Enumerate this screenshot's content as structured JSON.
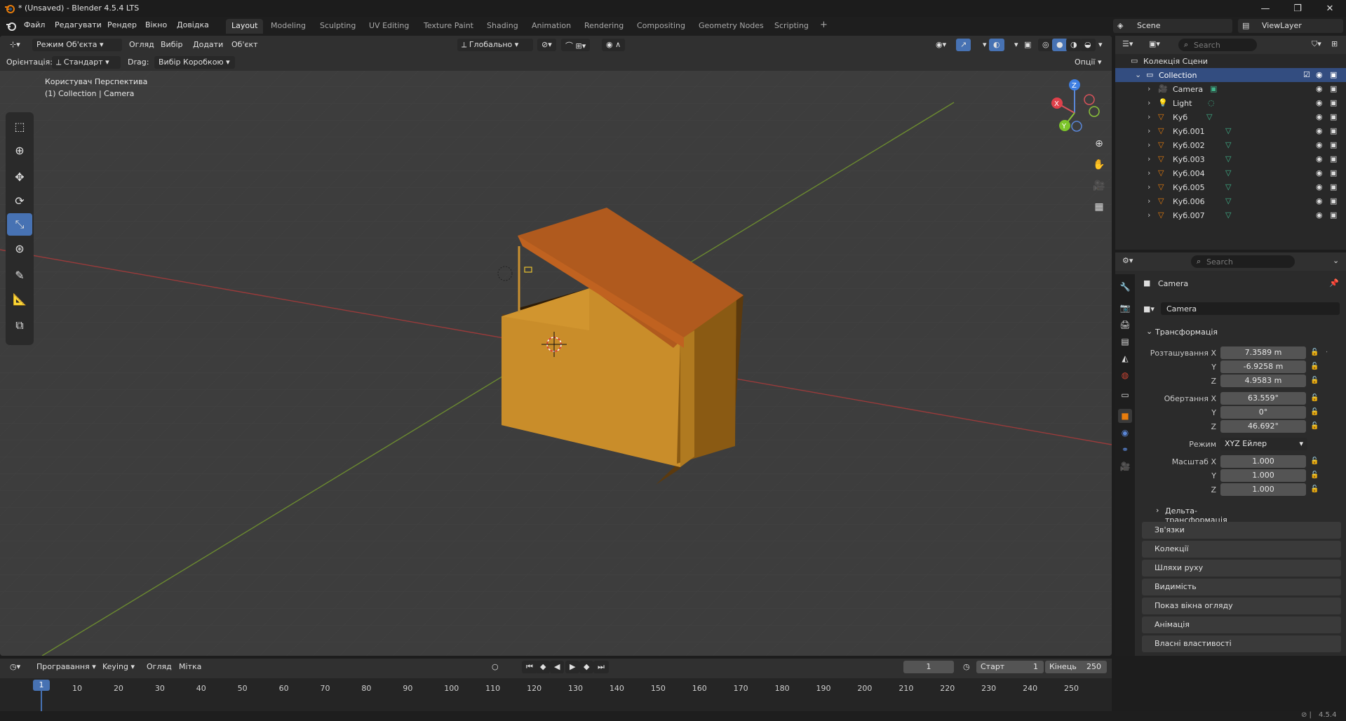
{
  "window": {
    "title": "* (Unsaved) - Blender 4.5.4 LTS"
  },
  "menu": [
    "Файл",
    "Редагувати",
    "Рендер",
    "Вікно",
    "Довідка"
  ],
  "workspaces": [
    "Layout",
    "Modeling",
    "Sculpting",
    "UV Editing",
    "Texture Paint",
    "Shading",
    "Animation",
    "Rendering",
    "Compositing",
    "Geometry Nodes",
    "Scripting"
  ],
  "workspace_add": "+",
  "scene": {
    "name": "Scene",
    "view_layer": "ViewLayer"
  },
  "viewport": {
    "mode": "Режим Об'єкта",
    "header_menus": [
      "Огляд",
      "Вибір",
      "Додати",
      "Об'єкт"
    ],
    "transform_orientation": "Глобально",
    "orientation_label": "Орієнтація:",
    "orientation_value": "Стандарт",
    "drag_label": "Drag:",
    "drag_value": "Вибір Коробкою",
    "options": "Опції",
    "overlay_title": "Користувач Перспектива",
    "overlay_subtitle": "(1) Collection | Camera",
    "gizmo": {
      "x": "X",
      "y": "Y",
      "z": "Z"
    }
  },
  "outliner": {
    "search_placeholder": "Search",
    "root": "Колекція Сцени",
    "collection": "Collection",
    "items": [
      "Camera",
      "Light",
      "Куб",
      "Куб.001",
      "Куб.002",
      "Куб.003",
      "Куб.004",
      "Куб.005",
      "Куб.006",
      "Куб.007"
    ]
  },
  "properties": {
    "search_placeholder": "Search",
    "object_name": "Camera",
    "object_field": "Camera",
    "transform_title": "Трансформація",
    "location_label": "Розташування X",
    "location": [
      "7.3589 m",
      "-6.9258 m",
      "4.9583 m"
    ],
    "rotation_label": "Обертання X",
    "rotation": [
      "63.559°",
      "0°",
      "46.692°"
    ],
    "mode_label": "Режим",
    "mode_value": "XYZ Ейлер",
    "scale_label": "Масштаб X",
    "scale": [
      "1.000",
      "1.000",
      "1.000"
    ],
    "axis_y": "Y",
    "axis_z": "Z",
    "delta": "Дельта-трансформація",
    "panels": [
      "Зв'язки",
      "Колекції",
      "Шляхи руху",
      "Видимість",
      "Показ вікна огляду",
      "Анімація",
      "Власні властивості"
    ]
  },
  "timeline": {
    "menus": [
      "Програвання",
      "Keying",
      "Огляд",
      "Мітка"
    ],
    "current_frame": "1",
    "start_label": "Старт",
    "start": "1",
    "end_label": "Кінець",
    "end": "250",
    "ticks": [
      "1",
      "10",
      "20",
      "30",
      "40",
      "50",
      "60",
      "70",
      "80",
      "90",
      "100",
      "110",
      "120",
      "130",
      "140",
      "150",
      "160",
      "170",
      "180",
      "190",
      "200",
      "210",
      "220",
      "230",
      "240",
      "250"
    ]
  },
  "status": {
    "version": "4.5.4"
  },
  "colors": {
    "accent": "#4772b3",
    "selection": "#334d80",
    "object_orange": "#d69a33",
    "roof": "#b85a1e"
  }
}
